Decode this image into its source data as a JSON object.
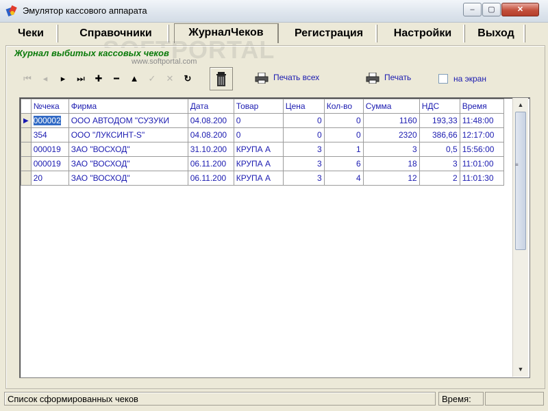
{
  "window": {
    "title": "Эмулятор кассового аппарата",
    "controls": {
      "minimize": "‒",
      "maximize": "▢",
      "close": "✕"
    }
  },
  "menu": {
    "items": [
      "Чеки",
      "Справочники",
      "ЖурналЧеков",
      "Регистрация",
      "Настройки",
      "Выход"
    ],
    "active_index": 2
  },
  "group": {
    "caption": "Журнал выбитых кассовых чеков"
  },
  "watermark": {
    "text": "SOFTPORTAL",
    "url": "www.softportal.com"
  },
  "toolbar": {
    "nav_buttons": [
      {
        "icon": "first-record-icon",
        "glyph": "⏮",
        "enabled": false
      },
      {
        "icon": "prior-record-icon",
        "glyph": "◂",
        "enabled": false
      },
      {
        "icon": "next-record-icon",
        "glyph": "▸",
        "enabled": true
      },
      {
        "icon": "last-record-icon",
        "glyph": "⏭",
        "enabled": true
      },
      {
        "icon": "insert-icon",
        "glyph": "✚",
        "enabled": true
      },
      {
        "icon": "delete-icon",
        "glyph": "━",
        "enabled": true
      },
      {
        "icon": "edit-icon",
        "glyph": "▲",
        "enabled": true
      },
      {
        "icon": "post-icon",
        "glyph": "✓",
        "enabled": false
      },
      {
        "icon": "cancel-icon",
        "glyph": "✕",
        "enabled": false
      },
      {
        "icon": "refresh-icon",
        "glyph": "↻",
        "enabled": true
      }
    ],
    "print_all_label": "Печать всех",
    "print_label": "Печать",
    "to_screen_label": "на экран",
    "to_screen_checked": false
  },
  "grid": {
    "columns": [
      "№чека",
      "Фирма",
      "Дата",
      "Товар",
      "Цена",
      "Кол-во",
      "Сумма",
      "НДС",
      "Время"
    ],
    "rows": [
      [
        "000002",
        "ООО АВТОДОМ \"СУЗУКИ",
        "04.08.200",
        "0",
        "0",
        "0",
        "1160",
        "193,33",
        "11:48:00"
      ],
      [
        "354",
        "ООО \"ЛУКСИНТ-S\"",
        "04.08.200",
        "0",
        "0",
        "0",
        "2320",
        "386,66",
        "12:17:00"
      ],
      [
        "000019",
        "ЗАО \"ВОСХОД\"",
        "31.10.200",
        "КРУПА  А",
        "3",
        "1",
        "3",
        "0,5",
        "15:56:00"
      ],
      [
        "000019",
        "ЗАО \"ВОСХОД\"",
        "06.11.200",
        "КРУПА  А",
        "3",
        "6",
        "18",
        "3",
        "11:01:00"
      ],
      [
        "20",
        "ЗАО \"ВОСХОД\"",
        "06.11.200",
        "КРУПА  А",
        "3",
        "4",
        "12",
        "2",
        "11:01:30"
      ]
    ],
    "current_row": 0,
    "row_indicator": "▶"
  },
  "status": {
    "message": "Список сформированных чеков",
    "time_label": "Время:",
    "time_value": ""
  },
  "colors": {
    "caption_green": "#0a7a0a",
    "grid_text_blue": "#1a1ab0",
    "selection": "#316ac5"
  }
}
